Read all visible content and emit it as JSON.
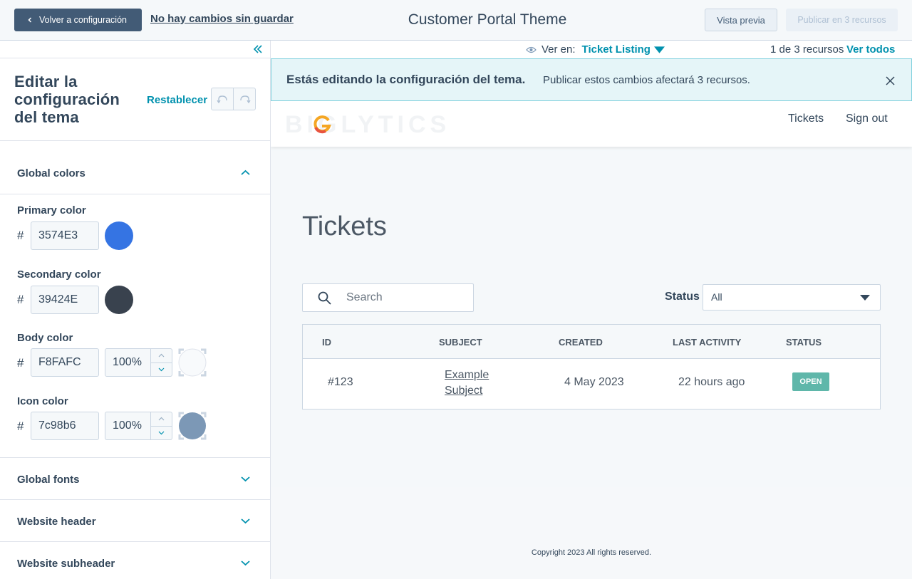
{
  "topbar": {
    "back_label": "Volver a configuración",
    "unsaved_label": "No hay cambios sin guardar",
    "title": "Customer Portal Theme",
    "preview_label": "Vista previa",
    "publish_label": "Publicar en 3 recursos"
  },
  "sidebar": {
    "heading": "Editar la configuración del tema",
    "reset_label": "Restablecer",
    "sections": {
      "global_colors": "Global colors",
      "global_fonts": "Global fonts",
      "website_header": "Website header",
      "website_subheader": "Website subheader"
    },
    "colors": {
      "hash": "#",
      "primary": {
        "label": "Primary color",
        "hex": "3574E3",
        "swatch": "#3574E3"
      },
      "secondary": {
        "label": "Secondary color",
        "hex": "39424E",
        "swatch": "#39424E"
      },
      "body": {
        "label": "Body color",
        "hex": "F8FAFC",
        "opacity": "100%",
        "swatch": "#F8FAFC"
      },
      "icon": {
        "label": "Icon color",
        "hex": "7c98b6",
        "opacity": "100%",
        "swatch": "#7c98b6"
      }
    }
  },
  "viewbar": {
    "view_on_label": "Ver en:",
    "view_target": "Ticket Listing",
    "resource_count": "1 de 3 recursos",
    "see_all": "Ver todos"
  },
  "alert": {
    "strong": "Estás editando la configuración del tema.",
    "message": "Publicar estos cambios afectará 3 recursos."
  },
  "site": {
    "logo": "BIGLYTICS",
    "nav_tickets": "Tickets",
    "nav_signout": "Sign out",
    "page_title": "Tickets",
    "search_placeholder": "Search",
    "status_label": "Status",
    "status_value": "All",
    "table": {
      "headers": [
        "ID",
        "SUBJECT",
        "CREATED",
        "LAST ACTIVITY",
        "STATUS"
      ],
      "rows": [
        {
          "id": "#123",
          "subject": "Example Subject",
          "created": "4 May 2023",
          "last_activity": "22 hours ago",
          "status": "OPEN"
        }
      ]
    },
    "copyright": "Copyright 2023 All rights reserved."
  }
}
